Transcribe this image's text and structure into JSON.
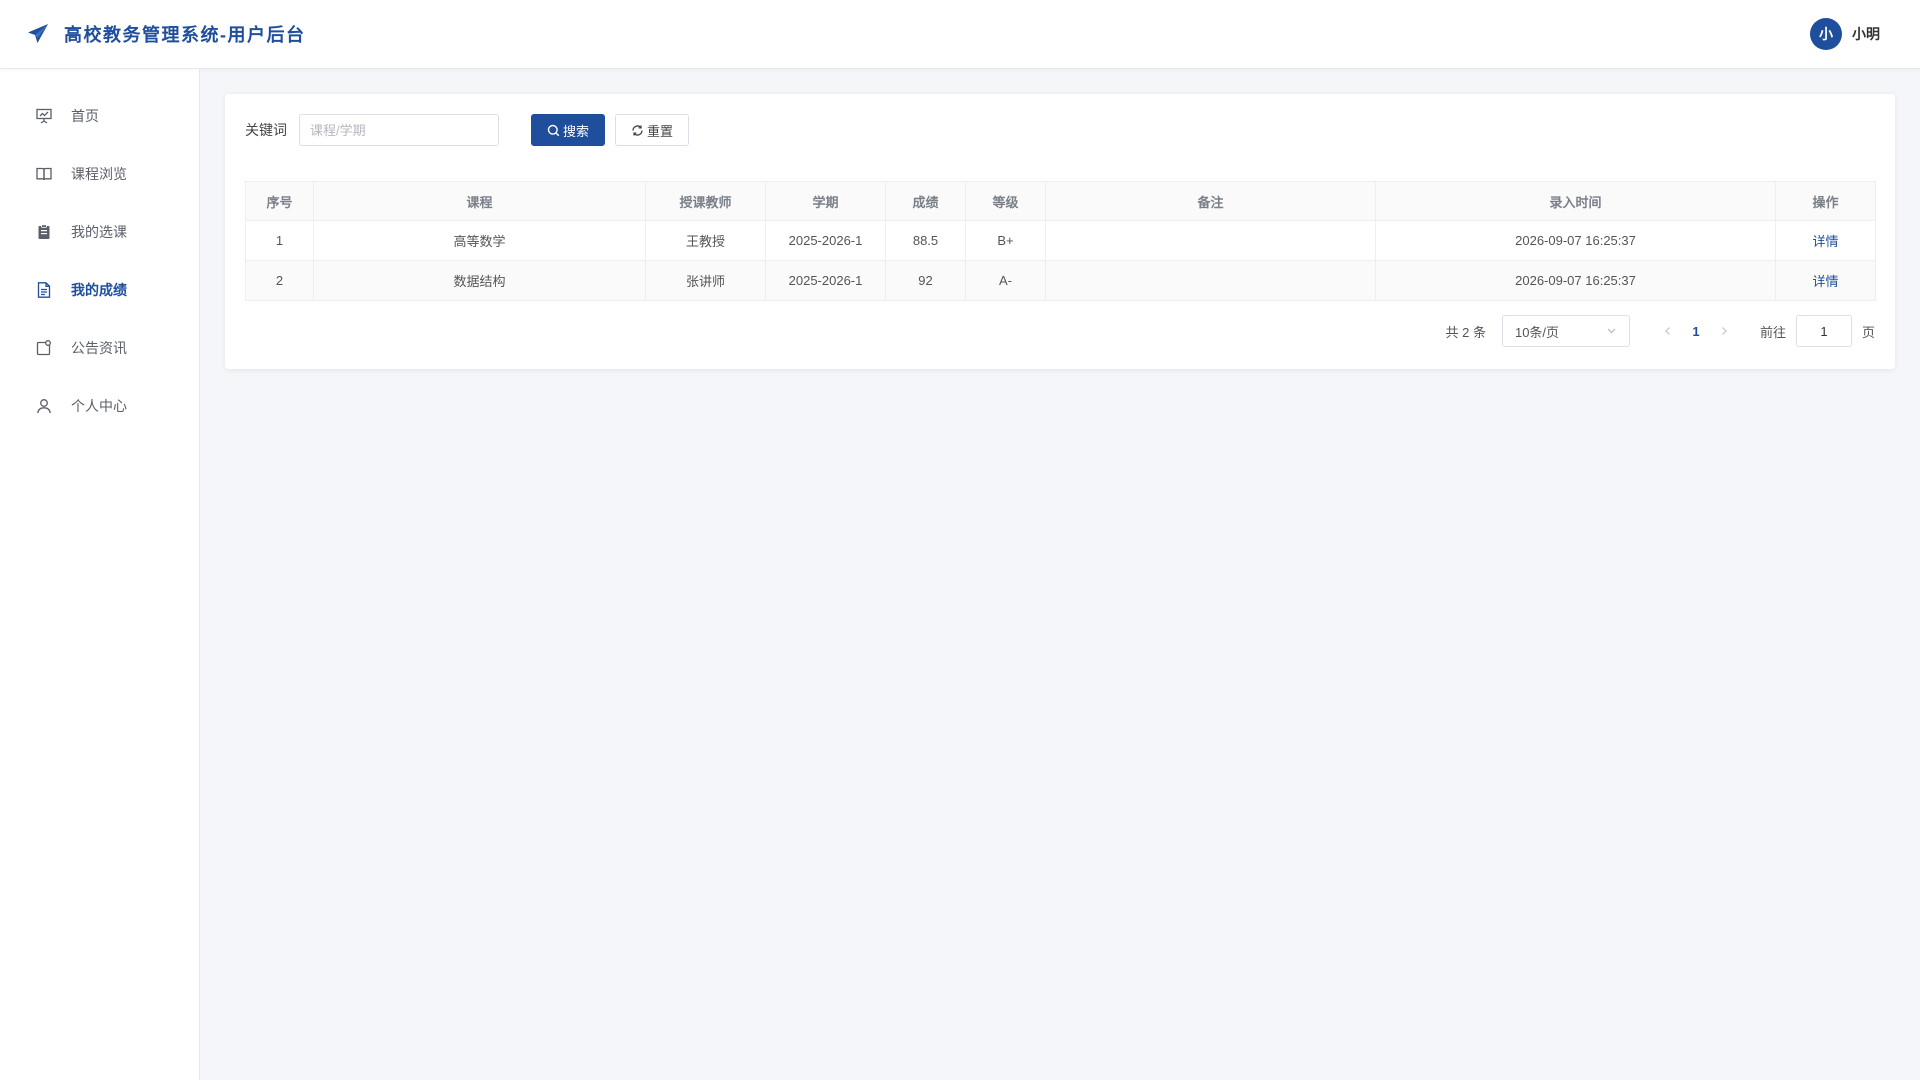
{
  "header": {
    "title": "高校教务管理系统-用户后台",
    "brand_icon": "paper-plane-icon",
    "user": {
      "avatar_text": "小",
      "name": "小明"
    }
  },
  "sidebar": {
    "items": [
      {
        "label": "首页",
        "icon": "presentation-board-icon",
        "active": false
      },
      {
        "label": "课程浏览",
        "icon": "book-icon",
        "active": false
      },
      {
        "label": "我的选课",
        "icon": "clipboard-icon",
        "active": false
      },
      {
        "label": "我的成绩",
        "icon": "document-icon",
        "active": true
      },
      {
        "label": "公告资讯",
        "icon": "notification-icon",
        "active": false
      },
      {
        "label": "个人中心",
        "icon": "user-icon",
        "active": false
      }
    ]
  },
  "search": {
    "keyword_label": "关键词",
    "placeholder": "课程/学期",
    "value": "",
    "search_label": "搜索",
    "reset_label": "重置"
  },
  "table": {
    "columns": [
      "序号",
      "课程",
      "授课教师",
      "学期",
      "成绩",
      "等级",
      "备注",
      "录入时间",
      "操作"
    ],
    "rows": [
      {
        "index": "1",
        "course": "高等数学",
        "teacher": "王教授",
        "term": "2025-2026-1",
        "score": "88.5",
        "grade": "B+",
        "remark": "",
        "time": "2026-09-07 16:25:37",
        "action": "详情"
      },
      {
        "index": "2",
        "course": "数据结构",
        "teacher": "张讲师",
        "term": "2025-2026-1",
        "score": "92",
        "grade": "A-",
        "remark": "",
        "time": "2026-09-07 16:25:37",
        "action": "详情"
      }
    ]
  },
  "pagination": {
    "total_text": "共 2 条",
    "page_size": "10条/页",
    "current_page": "1",
    "goto_label": "前往",
    "goto_value": "1",
    "page_unit": "页"
  },
  "colors": {
    "primary": "#1f4e9c",
    "background": "#f4f6fa"
  }
}
